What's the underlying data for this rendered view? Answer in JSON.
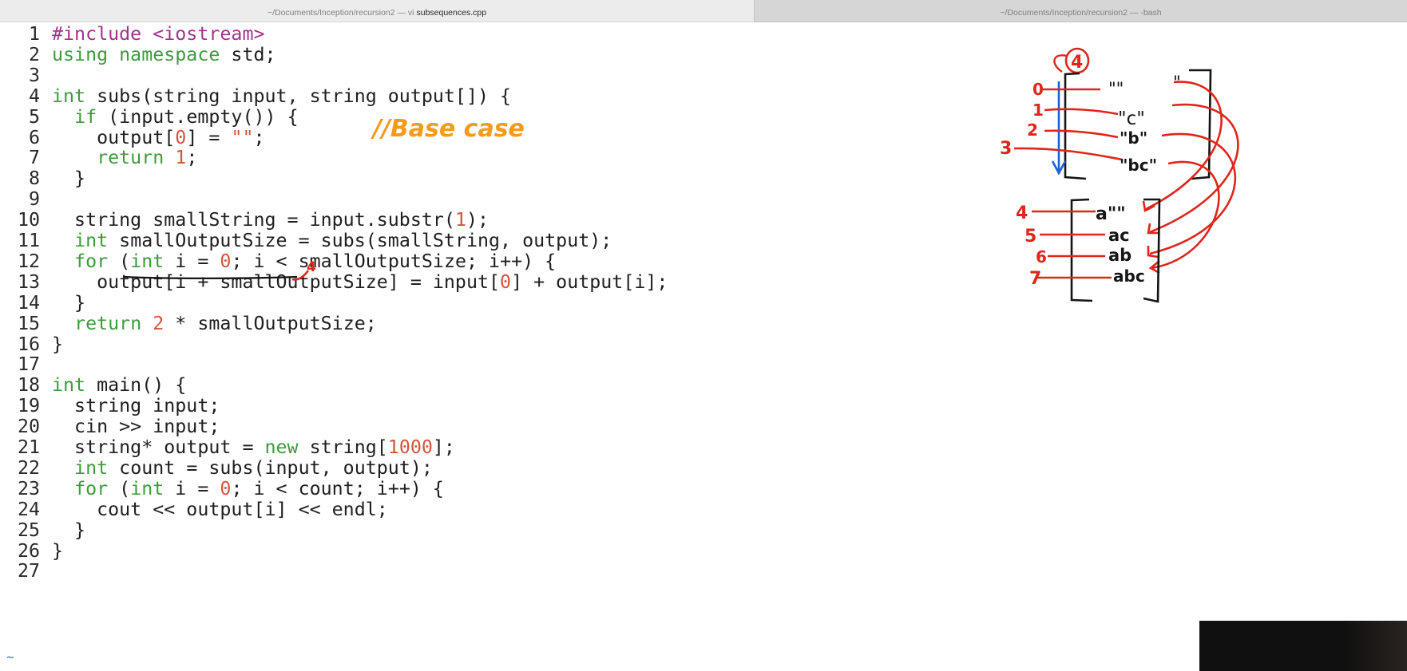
{
  "tabs": {
    "active": {
      "path": "~/Documents/Inception/recursion2 — vi",
      "file": "subsequences.cpp"
    },
    "inactive": {
      "title": "~/Documents/Inception/recursion2 — -bash"
    }
  },
  "editor": {
    "lines": [
      {
        "n": "1",
        "code": [
          {
            "t": "#include <iostream>",
            "c": "pp"
          }
        ]
      },
      {
        "n": "2",
        "code": [
          {
            "t": "using namespace",
            "c": "kw"
          },
          {
            "t": " std;"
          }
        ]
      },
      {
        "n": "3",
        "code": []
      },
      {
        "n": "4",
        "code": [
          {
            "t": "int",
            "c": "kw"
          },
          {
            "t": " subs(string input, string output[]) {"
          }
        ]
      },
      {
        "n": "5",
        "code": [
          {
            "t": "  "
          },
          {
            "t": "if",
            "c": "kw"
          },
          {
            "t": " (input.empty()) {"
          }
        ]
      },
      {
        "n": "6",
        "code": [
          {
            "t": "    output["
          },
          {
            "t": "0",
            "c": "num"
          },
          {
            "t": "] = "
          },
          {
            "t": "\"\"",
            "c": "str"
          },
          {
            "t": ";"
          }
        ]
      },
      {
        "n": "7",
        "code": [
          {
            "t": "    "
          },
          {
            "t": "return",
            "c": "kw"
          },
          {
            "t": " "
          },
          {
            "t": "1",
            "c": "num"
          },
          {
            "t": ";"
          }
        ]
      },
      {
        "n": "8",
        "code": [
          {
            "t": "  }"
          }
        ]
      },
      {
        "n": "9",
        "code": []
      },
      {
        "n": "10",
        "code": [
          {
            "t": "  string smallString = input.substr("
          },
          {
            "t": "1",
            "c": "num"
          },
          {
            "t": ");"
          }
        ]
      },
      {
        "n": "11",
        "code": [
          {
            "t": "  "
          },
          {
            "t": "int",
            "c": "kw"
          },
          {
            "t": " smallOutputSize = subs(smallString, output);"
          }
        ]
      },
      {
        "n": "12",
        "code": [
          {
            "t": "  "
          },
          {
            "t": "for",
            "c": "kw"
          },
          {
            "t": " ("
          },
          {
            "t": "int",
            "c": "kw"
          },
          {
            "t": " i = "
          },
          {
            "t": "0",
            "c": "num"
          },
          {
            "t": "; i < smallOutputSize; i++) {"
          }
        ]
      },
      {
        "n": "13",
        "code": [
          {
            "t": "    output[i + smallOutputSize] = input["
          },
          {
            "t": "0",
            "c": "num"
          },
          {
            "t": "] + output[i];"
          }
        ]
      },
      {
        "n": "14",
        "code": [
          {
            "t": "  }"
          }
        ]
      },
      {
        "n": "15",
        "code": [
          {
            "t": "  "
          },
          {
            "t": "return",
            "c": "kw"
          },
          {
            "t": " "
          },
          {
            "t": "2",
            "c": "num"
          },
          {
            "t": " * smallOutputSize;"
          }
        ]
      },
      {
        "n": "16",
        "code": [
          {
            "t": "}"
          }
        ]
      },
      {
        "n": "17",
        "code": []
      },
      {
        "n": "18",
        "code": [
          {
            "t": "int",
            "c": "kw"
          },
          {
            "t": " main() {"
          }
        ]
      },
      {
        "n": "19",
        "code": [
          {
            "t": "  string input;"
          }
        ]
      },
      {
        "n": "20",
        "code": [
          {
            "t": "  cin >> input;"
          }
        ]
      },
      {
        "n": "21",
        "code": [
          {
            "t": "  string* output = "
          },
          {
            "t": "new",
            "c": "kw"
          },
          {
            "t": " string["
          },
          {
            "t": "1000",
            "c": "num"
          },
          {
            "t": "];"
          }
        ]
      },
      {
        "n": "22",
        "code": [
          {
            "t": "  "
          },
          {
            "t": "int",
            "c": "kw"
          },
          {
            "t": " count = subs(input, output);"
          }
        ]
      },
      {
        "n": "23",
        "code": [
          {
            "t": "  "
          },
          {
            "t": "for",
            "c": "kw"
          },
          {
            "t": " ("
          },
          {
            "t": "int",
            "c": "kw"
          },
          {
            "t": " i = "
          },
          {
            "t": "0",
            "c": "num"
          },
          {
            "t": "; i < count; i++) {"
          }
        ]
      },
      {
        "n": "24",
        "code": [
          {
            "t": "    cout << output[i] << endl;"
          }
        ]
      },
      {
        "n": "25",
        "code": [
          {
            "t": "  }"
          }
        ]
      },
      {
        "n": "26",
        "code": [
          {
            "t": "}"
          }
        ]
      },
      {
        "n": "27",
        "code": []
      }
    ],
    "empty_line_marker": "~"
  },
  "annotations": {
    "comment": "//Base case",
    "line11_mark": "4",
    "top_size": "4",
    "top_indices": [
      "0",
      "1",
      "2",
      "3"
    ],
    "top_values": [
      "\"\"",
      "\"c\"",
      "\"b\"",
      "\"bc\""
    ],
    "bottom_indices": [
      "4",
      "5",
      "6",
      "7"
    ],
    "bottom_values": [
      "a\"\"",
      "ac",
      "ab",
      "abc"
    ]
  },
  "colors": {
    "ink_red": "#e0251b",
    "ink_blue": "#1f5fd6",
    "ink_orange": "#f59a1b",
    "ink_black": "#151515",
    "keyword": "#3f9a3f",
    "preprocessor": "#a0338c",
    "number": "#d4553d"
  }
}
